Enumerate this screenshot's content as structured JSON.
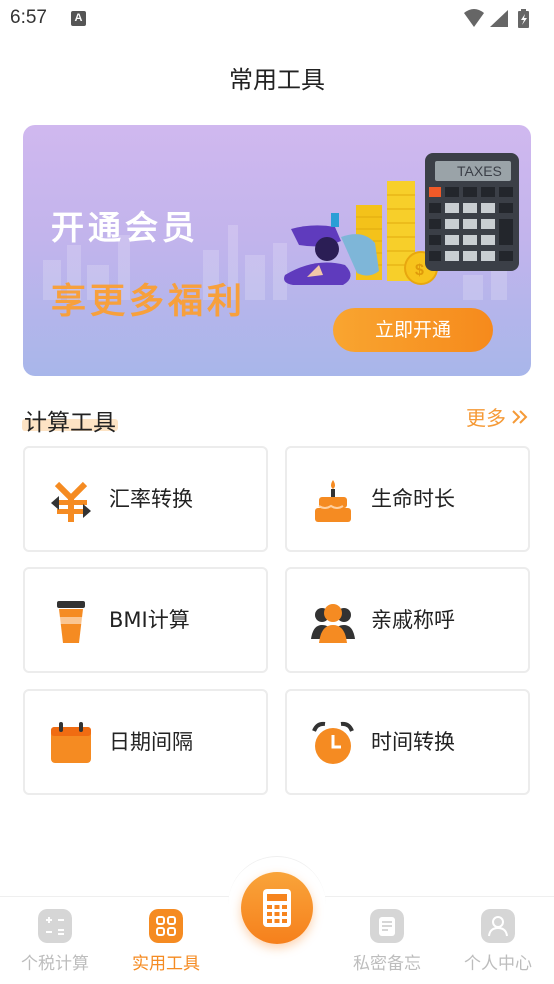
{
  "status_bar": {
    "time": "6:57",
    "notification_icon": "a-icon",
    "icons": [
      "wifi-icon",
      "signal-icon",
      "battery-charging-icon"
    ]
  },
  "page_title": "常用工具",
  "banner": {
    "title": "开通会员",
    "subtitle": "享更多福利",
    "button_label": "立即开通",
    "calculator_display": "TAXES"
  },
  "section": {
    "title": "计算工具",
    "more_label": "更多"
  },
  "tools": [
    {
      "label": "汇率转换",
      "icon": "exchange-rate-icon"
    },
    {
      "label": "生命时长",
      "icon": "cake-icon"
    },
    {
      "label": "BMI计算",
      "icon": "cup-icon"
    },
    {
      "label": "亲戚称呼",
      "icon": "people-icon"
    },
    {
      "label": "日期间隔",
      "icon": "calendar-icon"
    },
    {
      "label": "时间转换",
      "icon": "alarm-clock-icon"
    }
  ],
  "bottom_nav": {
    "items": [
      {
        "label": "个税计算",
        "icon": "tax-calc-icon",
        "active": false
      },
      {
        "label": "实用工具",
        "icon": "tools-grid-icon",
        "active": true
      },
      {
        "label": "私密备忘",
        "icon": "memo-icon",
        "active": false
      },
      {
        "label": "个人中心",
        "icon": "user-icon",
        "active": false
      }
    ],
    "center_icon": "calculator-icon"
  },
  "colors": {
    "accent": "#f58b22",
    "more_link": "#f59a37",
    "banner_subtitle": "#f7a03c",
    "nav_inactive": "#bdbdbd"
  }
}
